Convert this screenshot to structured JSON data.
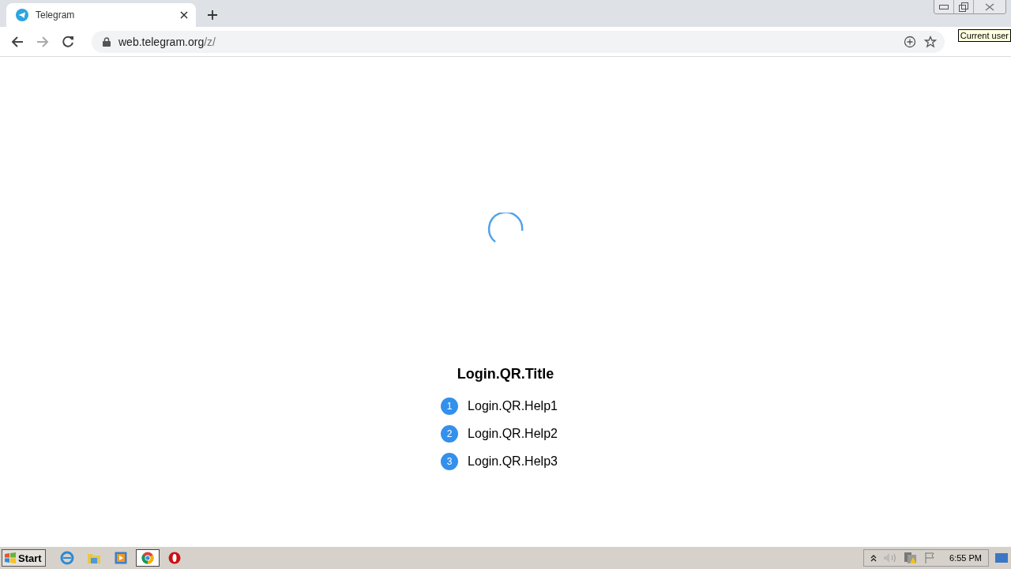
{
  "browser": {
    "tab": {
      "title": "Telegram",
      "selected": true
    },
    "url": {
      "host": "web.telegram.org",
      "path": "/z/"
    },
    "tooltip": "Current user"
  },
  "page": {
    "title": "Login.QR.Title",
    "steps": [
      {
        "number": "1",
        "text": "Login.QR.Help1"
      },
      {
        "number": "2",
        "text": "Login.QR.Help2"
      },
      {
        "number": "3",
        "text": "Login.QR.Help3"
      }
    ]
  },
  "taskbar": {
    "start": "Start",
    "apps": [
      {
        "kind": "ie",
        "selected": false
      },
      {
        "kind": "folder",
        "selected": false
      },
      {
        "kind": "media",
        "selected": false
      },
      {
        "kind": "chrome",
        "selected": true
      },
      {
        "kind": "opera",
        "selected": false
      }
    ],
    "clock": "6:55 PM"
  }
}
